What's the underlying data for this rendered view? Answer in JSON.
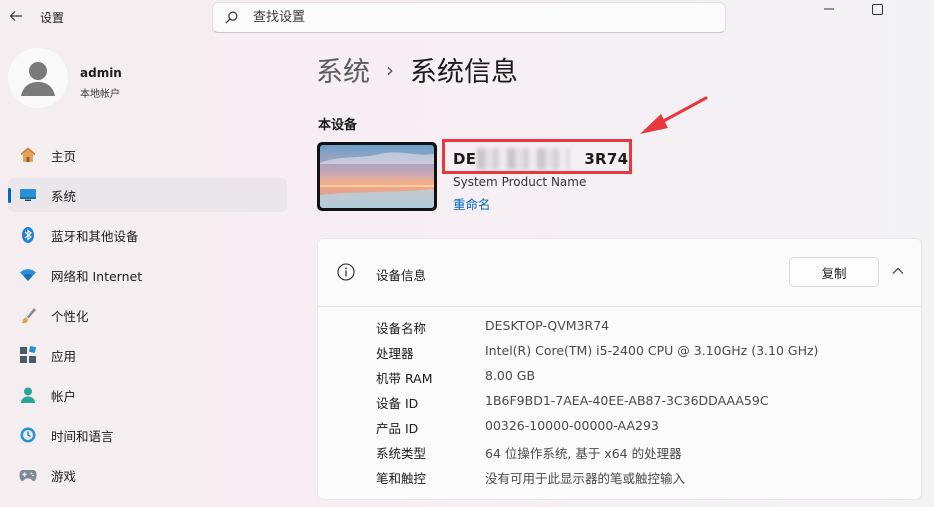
{
  "window": {
    "title": "设置",
    "back_icon": "back-arrow-icon",
    "minimize_icon": "minimize-icon",
    "maximize_icon": "maximize-icon"
  },
  "search": {
    "placeholder": "查找设置"
  },
  "profile": {
    "name": "admin",
    "account_type": "本地帐户"
  },
  "sidebar": {
    "items": [
      {
        "label": "主页",
        "icon": "home-icon"
      },
      {
        "label": "系统",
        "icon": "system-icon",
        "active": true
      },
      {
        "label": "蓝牙和其他设备",
        "icon": "bluetooth-icon"
      },
      {
        "label": "网络和 Internet",
        "icon": "wifi-icon"
      },
      {
        "label": "个性化",
        "icon": "brush-icon"
      },
      {
        "label": "应用",
        "icon": "apps-icon"
      },
      {
        "label": "帐户",
        "icon": "account-icon"
      },
      {
        "label": "时间和语言",
        "icon": "time-language-icon"
      },
      {
        "label": "游戏",
        "icon": "game-controller-icon"
      }
    ]
  },
  "breadcrumb": {
    "parent": "系统",
    "separator": "›",
    "current": "系统信息"
  },
  "device": {
    "section_label": "本设备",
    "name_visible_start": "DE",
    "name_visible_end": "3R74",
    "model": "System Product Name",
    "rename_label": "重命名"
  },
  "specs": {
    "title": "设备信息",
    "copy_label": "复制",
    "rows": [
      {
        "key": "设备名称",
        "value": "DESKTOP-QVM3R74"
      },
      {
        "key": "处理器",
        "value": "Intel(R) Core(TM) i5-2400 CPU @ 3.10GHz (3.10 GHz)"
      },
      {
        "key": "机带 RAM",
        "value": "8.00 GB"
      },
      {
        "key": "设备 ID",
        "value": "1B6F9BD1-7AEA-40EE-AB87-3C36DDAAA59C"
      },
      {
        "key": "产品 ID",
        "value": "00326-10000-00000-AA293"
      },
      {
        "key": "系统类型",
        "value": "64 位操作系统, 基于 x64 的处理器"
      },
      {
        "key": "笔和触控",
        "value": "没有可用于此显示器的笔或触控输入"
      }
    ]
  },
  "colors": {
    "accent": "#0067c0",
    "annotation": "#e8383d"
  }
}
